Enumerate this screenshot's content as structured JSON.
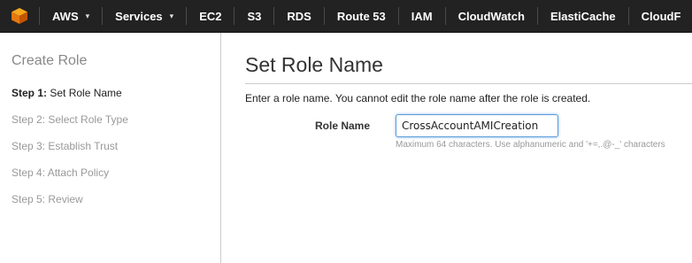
{
  "topbar": {
    "logo_icon": "aws-cube-icon",
    "background": "#222222",
    "items": [
      {
        "label": "AWS",
        "has_caret": true
      },
      {
        "label": "Services",
        "has_caret": true
      },
      {
        "label": "EC2",
        "has_caret": false
      },
      {
        "label": "S3",
        "has_caret": false
      },
      {
        "label": "RDS",
        "has_caret": false
      },
      {
        "label": "Route 53",
        "has_caret": false
      },
      {
        "label": "IAM",
        "has_caret": false
      },
      {
        "label": "CloudWatch",
        "has_caret": false
      },
      {
        "label": "ElastiCache",
        "has_caret": false
      },
      {
        "label": "CloudF",
        "has_caret": false
      }
    ],
    "caret_glyph": "▾"
  },
  "sidebar": {
    "title": "Create Role",
    "steps": [
      {
        "num": "Step 1:",
        "label": "Set Role Name",
        "active": true
      },
      {
        "num": "Step 2:",
        "label": "Select Role Type",
        "active": false
      },
      {
        "num": "Step 3:",
        "label": "Establish Trust",
        "active": false
      },
      {
        "num": "Step 4:",
        "label": "Attach Policy",
        "active": false
      },
      {
        "num": "Step 5:",
        "label": "Review",
        "active": false
      }
    ]
  },
  "main": {
    "title": "Set Role Name",
    "instruction": "Enter a role name. You cannot edit the role name after the role is created.",
    "role_name": {
      "label": "Role Name",
      "value": "CrossAccountAMICreation",
      "hint": "Maximum 64 characters. Use alphanumeric and '+=,.@-_' characters"
    }
  },
  "colors": {
    "accent": "#ff9900",
    "input_focus": "#5b9dd9"
  }
}
